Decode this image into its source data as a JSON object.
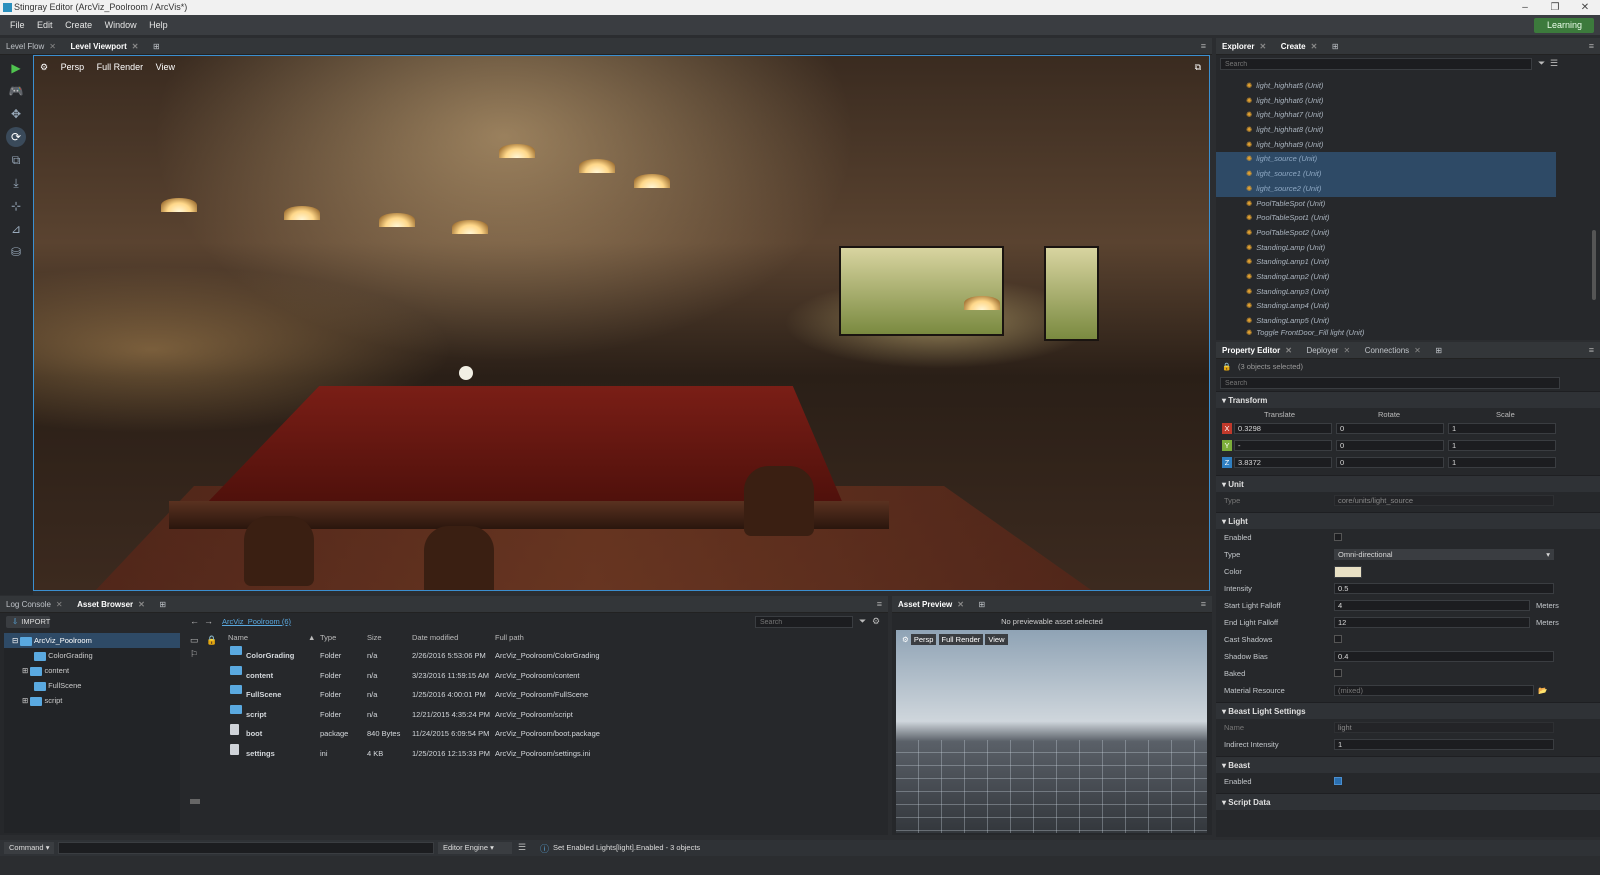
{
  "window": {
    "title": "Stingray Editor (ArcViz_Poolroom / ArcVis*)",
    "minimize": "–",
    "restore": "❐",
    "close": "✕"
  },
  "menu": [
    "File",
    "Edit",
    "Create",
    "Window",
    "Help"
  ],
  "learning_label": "Learning",
  "left_tabs": [
    {
      "label": "Level Flow",
      "active": false
    },
    {
      "label": "Level Viewport",
      "active": true
    }
  ],
  "viewport": {
    "camera": "Persp",
    "render": "Full Render",
    "view": "View"
  },
  "tools": [
    "play-icon",
    "gamepad-icon",
    "move-icon",
    "rotate-icon",
    "scale-icon",
    "snap-icon",
    "transform-icon",
    "measure-icon",
    "asset-icon"
  ],
  "explorer": {
    "tabs": [
      {
        "label": "Explorer",
        "active": true
      },
      {
        "label": "Create",
        "active": false
      }
    ],
    "search_placeholder": "Search",
    "items": [
      {
        "label": "light_highhat5 (Unit)",
        "sel": false
      },
      {
        "label": "light_highhat6 (Unit)",
        "sel": false
      },
      {
        "label": "light_highhat7 (Unit)",
        "sel": false
      },
      {
        "label": "light_highhat8 (Unit)",
        "sel": false
      },
      {
        "label": "light_highhat9 (Unit)",
        "sel": false
      },
      {
        "label": "light_source (Unit)",
        "sel": true
      },
      {
        "label": "light_source1 (Unit)",
        "sel": true
      },
      {
        "label": "light_source2 (Unit)",
        "sel": true
      },
      {
        "label": "PoolTableSpot (Unit)",
        "sel": false
      },
      {
        "label": "PoolTableSpot1 (Unit)",
        "sel": false
      },
      {
        "label": "PoolTableSpot2 (Unit)",
        "sel": false
      },
      {
        "label": "StandingLamp (Unit)",
        "sel": false
      },
      {
        "label": "StandingLamp1 (Unit)",
        "sel": false
      },
      {
        "label": "StandingLamp2 (Unit)",
        "sel": false
      },
      {
        "label": "StandingLamp3 (Unit)",
        "sel": false
      },
      {
        "label": "StandingLamp4 (Unit)",
        "sel": false
      },
      {
        "label": "StandingLamp5 (Unit)",
        "sel": false
      },
      {
        "label": "Toggle FrontDoor_Fill light (Unit)",
        "sel": false
      }
    ]
  },
  "property_editor": {
    "tabs": [
      {
        "label": "Property Editor",
        "active": true
      },
      {
        "label": "Deployer",
        "active": false
      },
      {
        "label": "Connections",
        "active": false
      }
    ],
    "selection": "(3 objects selected)",
    "search_placeholder": "Search",
    "transform": {
      "title": "Transform",
      "headers": [
        "Translate",
        "Rotate",
        "Scale"
      ],
      "rows": [
        {
          "axis": "X",
          "color": "#c0392b",
          "t": "0.3298",
          "r": "0",
          "s": "1"
        },
        {
          "axis": "Y",
          "color": "#7cae3a",
          "t": "-",
          "r": "0",
          "s": "1"
        },
        {
          "axis": "Z",
          "color": "#2f7fc1",
          "t": "3.8372",
          "r": "0",
          "s": "1"
        }
      ]
    },
    "unit": {
      "title": "Unit",
      "type_label": "Type",
      "type_value": "core/units/light_source"
    },
    "light": {
      "title": "Light",
      "enabled": "Enabled",
      "type_label": "Type",
      "type_value": "Omni-directional",
      "color_label": "Color",
      "color_value": "#e8e0c4",
      "intensity_label": "Intensity",
      "intensity_value": "0.5",
      "start_label": "Start Light Falloff",
      "start_value": "4",
      "start_unit": "Meters",
      "end_label": "End Light Falloff",
      "end_value": "12",
      "end_unit": "Meters",
      "cast_label": "Cast Shadows",
      "bias_label": "Shadow Bias",
      "bias_value": "0.4",
      "baked_label": "Baked",
      "material_label": "Material Resource",
      "material_value": "(mixed)"
    },
    "beast_light": {
      "title": "Beast Light Settings",
      "name_label": "Name",
      "name_value": "light",
      "indirect_label": "Indirect Intensity",
      "indirect_value": "1"
    },
    "beast": {
      "title": "Beast",
      "enabled": "Enabled"
    },
    "script": {
      "title": "Script Data"
    }
  },
  "bottom_tabs": [
    {
      "label": "Log Console",
      "active": false
    },
    {
      "label": "Asset Browser",
      "active": true
    }
  ],
  "asset_browser": {
    "import_label": "IMPORT",
    "path": "ArcViz_Poolroom (6)",
    "search_placeholder": "Search",
    "tree": [
      {
        "label": "ArcViz_Poolroom",
        "root": true
      },
      {
        "label": "ColorGrading",
        "root": false
      },
      {
        "label": "content",
        "root": false
      },
      {
        "label": "FullScene",
        "root": false
      },
      {
        "label": "script",
        "root": false
      }
    ],
    "columns": [
      "Name",
      "Type",
      "Size",
      "Date modified",
      "Full path"
    ],
    "rows": [
      {
        "name": "ColorGrading",
        "type": "Folder",
        "size": "n/a",
        "date": "2/26/2016 5:53:06 PM",
        "path": "ArcViz_Poolroom/ColorGrading",
        "kind": "folder"
      },
      {
        "name": "content",
        "type": "Folder",
        "size": "n/a",
        "date": "3/23/2016 11:59:15 AM",
        "path": "ArcViz_Poolroom/content",
        "kind": "folder"
      },
      {
        "name": "FullScene",
        "type": "Folder",
        "size": "n/a",
        "date": "1/25/2016 4:00:01 PM",
        "path": "ArcViz_Poolroom/FullScene",
        "kind": "folder"
      },
      {
        "name": "script",
        "type": "Folder",
        "size": "n/a",
        "date": "12/21/2015 4:35:24 PM",
        "path": "ArcViz_Poolroom/script",
        "kind": "folder"
      },
      {
        "name": "boot",
        "type": "package",
        "size": "840 Bytes",
        "date": "11/24/2015 6:09:54 PM",
        "path": "ArcViz_Poolroom/boot.package",
        "kind": "file"
      },
      {
        "name": "settings",
        "type": "ini",
        "size": "4 KB",
        "date": "1/25/2016 12:15:33 PM",
        "path": "ArcViz_Poolroom/settings.ini",
        "kind": "file"
      }
    ]
  },
  "asset_preview": {
    "tab": "Asset Preview",
    "status": "No previewable asset selected",
    "camera": "Persp",
    "render": "Full Render",
    "view": "View"
  },
  "statusbar": {
    "command": "Command",
    "engine": "Editor Engine",
    "message": "Set Enabled Lights[light].Enabled - 3 objects"
  }
}
